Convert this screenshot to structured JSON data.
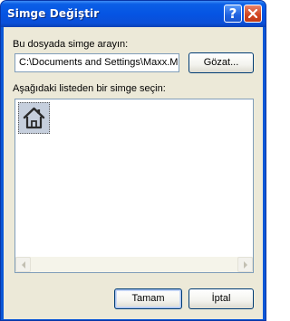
{
  "window": {
    "title": "Simge Değiştir",
    "help_glyph": "?",
    "accent_color": "#0a57d6"
  },
  "file_section": {
    "label": "Bu dosyada simge arayın:",
    "path_value": "C:\\Documents and Settings\\Maxx.M",
    "browse_label": "Gözat..."
  },
  "icon_list": {
    "label": "Aşağıdaki listeden bir simge seçin:",
    "items": [
      {
        "icon": "home-icon",
        "selected": true
      }
    ]
  },
  "footer": {
    "ok_label": "Tamam",
    "cancel_label": "İptal"
  }
}
